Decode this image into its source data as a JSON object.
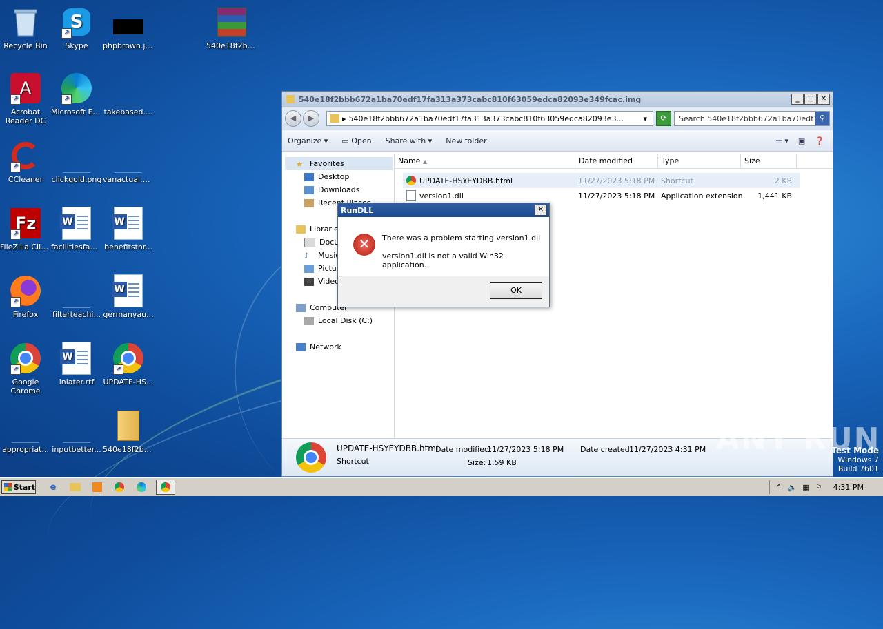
{
  "desktop": {
    "icons": [
      {
        "label": "Recycle Bin"
      },
      {
        "label": "Skype"
      },
      {
        "label": "phpbrown.jpg"
      },
      {
        "label": "540e18f2bb..."
      },
      {
        "label": "Acrobat Reader DC"
      },
      {
        "label": "Microsoft Edge"
      },
      {
        "label": "takebased...."
      },
      {
        "label": "CCleaner"
      },
      {
        "label": "clickgold.png"
      },
      {
        "label": "vanactual.png"
      },
      {
        "label": "FileZilla Client"
      },
      {
        "label": "facilitiesfan.rtf"
      },
      {
        "label": "benefitsthr..."
      },
      {
        "label": "Firefox"
      },
      {
        "label": "filterteachi..."
      },
      {
        "label": "germanyau..."
      },
      {
        "label": "Google Chrome"
      },
      {
        "label": "inlater.rtf"
      },
      {
        "label": "UPDATE-HS..."
      },
      {
        "label": "appropriat..."
      },
      {
        "label": "inputbetter..."
      },
      {
        "label": "540e18f2bb..."
      }
    ]
  },
  "explorer": {
    "title": "540e18f2bbb672a1ba70edf17fa313a373cabc810f63059edca82093e349fcac.img",
    "address": "540e18f2bbb672a1ba70edf17fa313a373cabc810f63059edca82093e3...",
    "search_placeholder": "Search 540e18f2bbb672a1ba70edf17f...",
    "toolbar": {
      "organize": "Organize",
      "open": "Open",
      "share": "Share with",
      "new_folder": "New folder"
    },
    "nav": {
      "favorites": "Favorites",
      "desktop": "Desktop",
      "downloads": "Downloads",
      "recent": "Recent Places",
      "libraries": "Libraries",
      "documents": "Documents",
      "music": "Music",
      "pictures": "Pictures",
      "videos": "Videos",
      "computer": "Computer",
      "local_disk": "Local Disk (C:)",
      "network": "Network"
    },
    "columns": {
      "name": "Name",
      "date": "Date modified",
      "type": "Type",
      "size": "Size"
    },
    "files": [
      {
        "name": "UPDATE-HSYEYDBB.html",
        "date": "11/27/2023 5:18 PM",
        "type": "Shortcut",
        "size": "2 KB"
      },
      {
        "name": "version1.dll",
        "date": "11/27/2023 5:18 PM",
        "type": "Application extension",
        "size": "1,441 KB"
      }
    ],
    "details": {
      "name": "UPDATE-HSYEYDBB.html",
      "kind": "Shortcut",
      "modified_label": "Date modified:",
      "modified": "11/27/2023 5:18 PM",
      "size_label": "Size:",
      "size": "1.59 KB",
      "created_label": "Date created:",
      "created": "11/27/2023 4:31 PM"
    }
  },
  "dialog": {
    "title": "RunDLL",
    "message1": "There was a problem starting version1.dll",
    "message2": "version1.dll is not a valid Win32 application.",
    "ok": "OK"
  },
  "taskbar": {
    "start": "Start",
    "clock": "4:31 PM"
  },
  "watermark": "ANY RUN",
  "testmode": {
    "line1": "Test Mode",
    "line2": "Windows 7",
    "line3": "Build 7601"
  }
}
